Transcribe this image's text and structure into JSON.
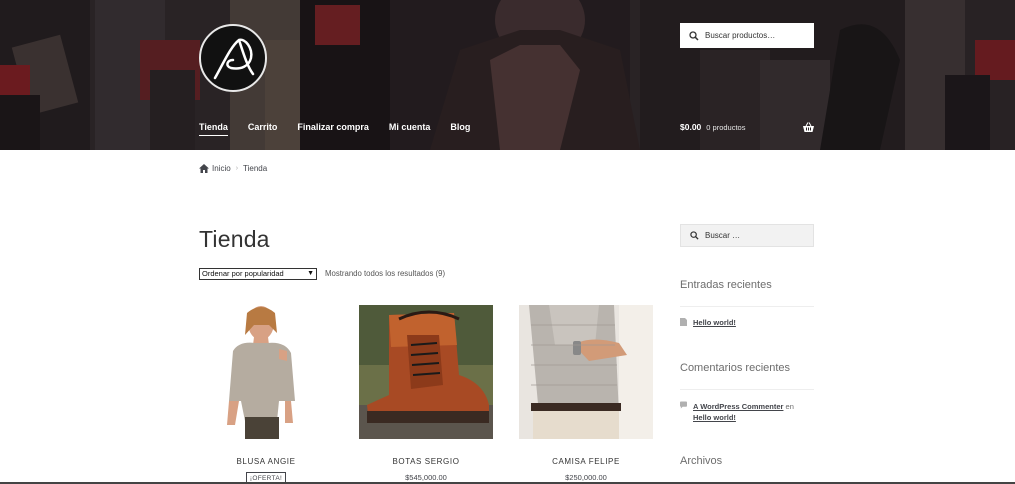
{
  "header": {
    "search_placeholder": "Buscar productos…",
    "nav": [
      "Tienda",
      "Carrito",
      "Finalizar compra",
      "Mi cuenta",
      "Blog"
    ],
    "cart_amount": "$0.00",
    "cart_count": "0 productos"
  },
  "breadcrumb": {
    "home": "Inicio",
    "current": "Tienda"
  },
  "page": {
    "title": "Tienda",
    "orderby_selected": "Ordenar por popularidad",
    "result_count": "Mostrando todos los resultados (9)"
  },
  "products": [
    {
      "name": "BLUSA ANGIE",
      "badge": "¡OFERTA!"
    },
    {
      "name": "BOTAS SERGIO",
      "price": "$545,000.00"
    },
    {
      "name": "CAMISA FELIPE",
      "price": "$250,000.00"
    }
  ],
  "sidebar": {
    "search_placeholder": "Buscar …",
    "recent_posts_title": "Entradas recientes",
    "recent_posts": [
      "Hello world!"
    ],
    "recent_comments_title": "Comentarios recientes",
    "comment": {
      "author": "A WordPress Commenter",
      "connector": "en",
      "post": "Hello world!"
    },
    "archives_title": "Archivos"
  },
  "colors": {
    "header_overlay": "#2a2426",
    "accent_red": "#c0272d",
    "text": "#43454b"
  },
  "icons": [
    "search-icon",
    "home-icon",
    "shopping-basket-icon",
    "document-icon",
    "comment-icon",
    "logo"
  ]
}
